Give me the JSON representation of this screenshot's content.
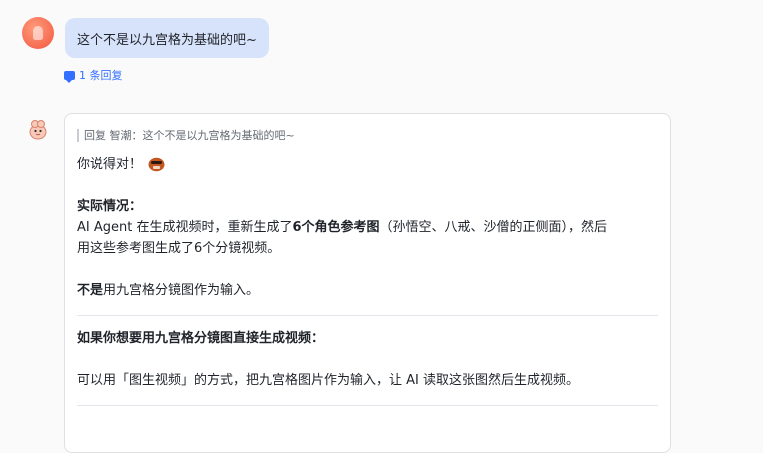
{
  "user_message": {
    "text": "这个不是以九宫格为基础的吧~",
    "reply_count": "1 条回复"
  },
  "bot_reply": {
    "quote": "回复 智潮：这个不是以九宫格为基础的吧~",
    "line1": "你说得对！",
    "heading": "实际情况：",
    "para_prefix": "AI Agent 在生成视频时，重新生成了",
    "para_bold": "6个角色参考图",
    "para_suffix": "（孙悟空、八戒、沙僧的正侧面），然后",
    "para_line2": "用这些参考图生成了6个分镜视频。",
    "not_bold": "不是",
    "not_rest": "用九宫格分镜图作为输入。",
    "section_title": "如果你想要用九宫格分镜图直接生成视频：",
    "suggestion": "可以用「图生视频」的方式，把九宫格图片作为输入，让 AI 读取这张图然后生成视频。"
  },
  "icons": {
    "reply": "chat-bubble-icon",
    "bot_avatar": "mascot-icon",
    "emoji": "embarrassed-emoji-icon"
  },
  "colors": {
    "accent": "#3370ff",
    "bubble": "#d7e3fb",
    "background": "#fafafb"
  }
}
